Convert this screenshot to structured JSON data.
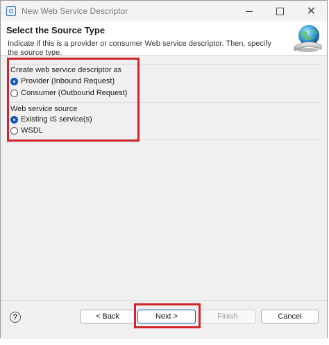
{
  "window": {
    "title": "New Web Service Descriptor",
    "icons": {
      "app": "app-icon",
      "minimize": "minimize-icon",
      "maximize": "maximize-icon",
      "close": "close-icon"
    },
    "close_glyph": "✕"
  },
  "header": {
    "title": "Select the Source Type",
    "description": "Indicate if this is a provider or consumer Web service descriptor. Then, specify the source type.",
    "image_icon": "web-service-globe-icon"
  },
  "descriptor_group": {
    "label": "Create web service descriptor as",
    "options": [
      {
        "label": "Provider (Inbound Request)",
        "checked": true
      },
      {
        "label": "Consumer (Outbound Request)",
        "checked": false
      }
    ]
  },
  "source_group": {
    "label": "Web service source",
    "options": [
      {
        "label": "Existing IS service(s)",
        "checked": true
      },
      {
        "label": "WSDL",
        "checked": false
      }
    ]
  },
  "footer": {
    "help_glyph": "?",
    "back_label": "< Back",
    "next_label": "Next >",
    "finish_label": "Finish",
    "cancel_label": "Cancel"
  },
  "colors": {
    "highlight": "#d2232a",
    "accent": "#0b57c4"
  }
}
